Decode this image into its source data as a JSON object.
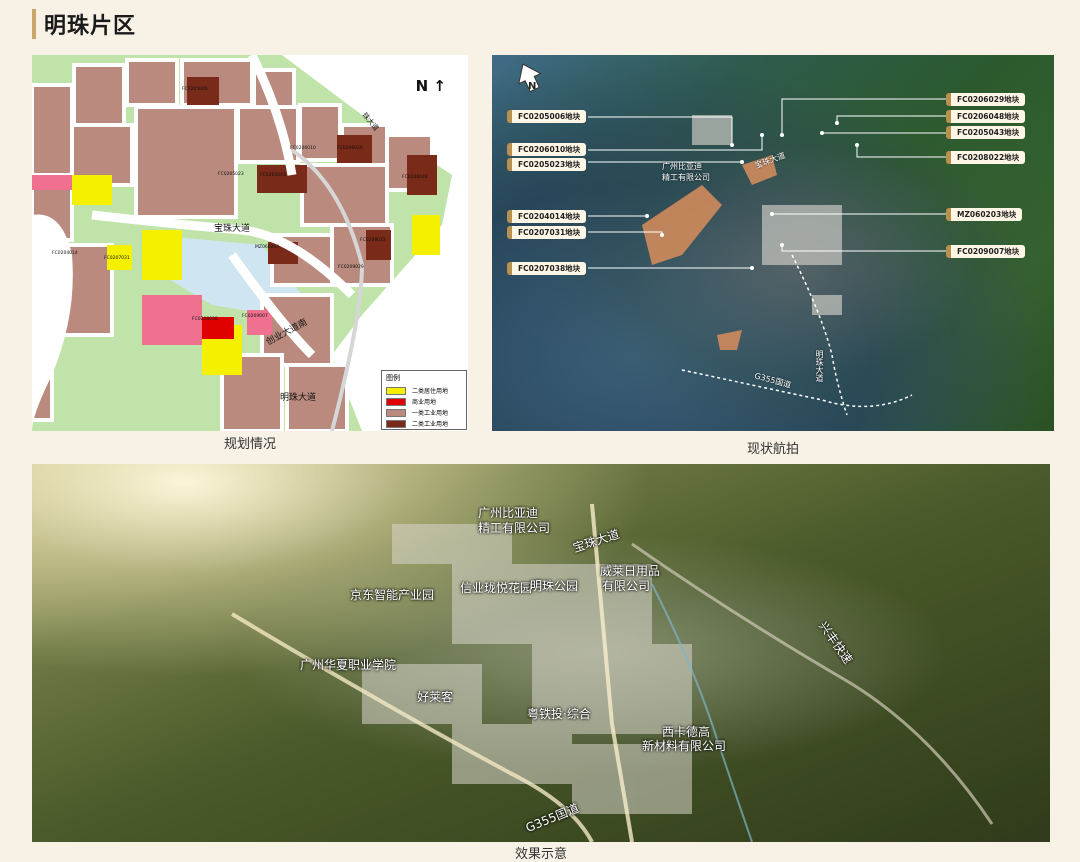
{
  "page": {
    "title": "明珠片区"
  },
  "planning_map": {
    "compass": "N ↑",
    "caption": "规划情况",
    "road_labels": [
      "宝珠大道",
      "创业大道南",
      "明珠大道",
      "珠大道"
    ],
    "parcel_codes": [
      "FC0205006",
      "FC0206010",
      "FC0206029",
      "FC0205023",
      "FC0205043",
      "FC0206048",
      "FC0204014",
      "FC0207031",
      "MZ060203",
      "FC0208022",
      "FC0209029",
      "FC0208038",
      "FC0209007"
    ],
    "legend": {
      "title": "图例",
      "items": [
        {
          "label": "二类居住用地",
          "color": "#f5f000"
        },
        {
          "label": "商业用地",
          "color": "#e00000"
        },
        {
          "label": "一类工业用地",
          "color": "#b98a7d"
        },
        {
          "label": "二类工业用地",
          "color": "#7a2a18"
        }
      ]
    }
  },
  "aerial": {
    "caption": "现状航拍",
    "compass": "N",
    "left_tags": [
      "FC0205006地块",
      "FC0206010地块",
      "FC0205023地块",
      "FC0204014地块",
      "FC0207031地块",
      "FC0207038地块"
    ],
    "right_tags": [
      "FC0206029地块",
      "FC0206048地块",
      "FC0205043地块",
      "FC0208022地块",
      "MZ060203地块",
      "FC0209007地块"
    ],
    "labels": [
      "广州比亚迪",
      "精工有限公司",
      "宝珠大道",
      "明珠大道",
      "G355国道"
    ]
  },
  "rendering": {
    "caption": "效果示意",
    "labels": [
      "广州比亚迪",
      "精工有限公司",
      "宝珠大道",
      "威莱日用品",
      "有限公司",
      "京东智能产业园",
      "信业珑悦花园",
      "明珠公园",
      "广州华夏职业学院",
      "好莱客",
      "粤铁投·综合",
      "西卡德高",
      "新材料有限公司",
      "G355国道",
      "兴丰快速"
    ]
  },
  "colors": {
    "accent": "#c9a66b",
    "background": "#f7f1e6"
  }
}
